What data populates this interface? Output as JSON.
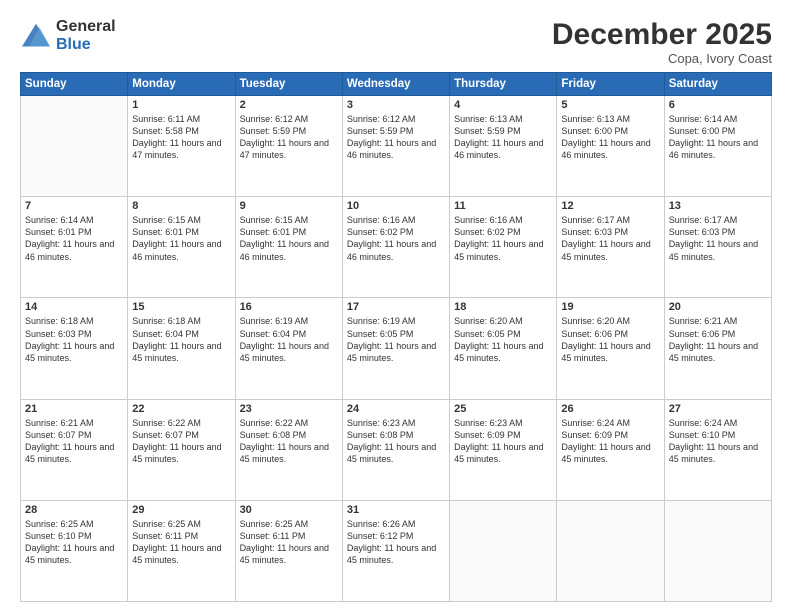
{
  "logo": {
    "general": "General",
    "blue": "Blue"
  },
  "header": {
    "month": "December 2025",
    "location": "Copa, Ivory Coast"
  },
  "days": [
    "Sunday",
    "Monday",
    "Tuesday",
    "Wednesday",
    "Thursday",
    "Friday",
    "Saturday"
  ],
  "weeks": [
    [
      {
        "day": "",
        "sunrise": "",
        "sunset": "",
        "daylight": ""
      },
      {
        "day": "1",
        "sunrise": "Sunrise: 6:11 AM",
        "sunset": "Sunset: 5:58 PM",
        "daylight": "Daylight: 11 hours and 47 minutes."
      },
      {
        "day": "2",
        "sunrise": "Sunrise: 6:12 AM",
        "sunset": "Sunset: 5:59 PM",
        "daylight": "Daylight: 11 hours and 47 minutes."
      },
      {
        "day": "3",
        "sunrise": "Sunrise: 6:12 AM",
        "sunset": "Sunset: 5:59 PM",
        "daylight": "Daylight: 11 hours and 46 minutes."
      },
      {
        "day": "4",
        "sunrise": "Sunrise: 6:13 AM",
        "sunset": "Sunset: 5:59 PM",
        "daylight": "Daylight: 11 hours and 46 minutes."
      },
      {
        "day": "5",
        "sunrise": "Sunrise: 6:13 AM",
        "sunset": "Sunset: 6:00 PM",
        "daylight": "Daylight: 11 hours and 46 minutes."
      },
      {
        "day": "6",
        "sunrise": "Sunrise: 6:14 AM",
        "sunset": "Sunset: 6:00 PM",
        "daylight": "Daylight: 11 hours and 46 minutes."
      }
    ],
    [
      {
        "day": "7",
        "sunrise": "Sunrise: 6:14 AM",
        "sunset": "Sunset: 6:01 PM",
        "daylight": "Daylight: 11 hours and 46 minutes."
      },
      {
        "day": "8",
        "sunrise": "Sunrise: 6:15 AM",
        "sunset": "Sunset: 6:01 PM",
        "daylight": "Daylight: 11 hours and 46 minutes."
      },
      {
        "day": "9",
        "sunrise": "Sunrise: 6:15 AM",
        "sunset": "Sunset: 6:01 PM",
        "daylight": "Daylight: 11 hours and 46 minutes."
      },
      {
        "day": "10",
        "sunrise": "Sunrise: 6:16 AM",
        "sunset": "Sunset: 6:02 PM",
        "daylight": "Daylight: 11 hours and 46 minutes."
      },
      {
        "day": "11",
        "sunrise": "Sunrise: 6:16 AM",
        "sunset": "Sunset: 6:02 PM",
        "daylight": "Daylight: 11 hours and 45 minutes."
      },
      {
        "day": "12",
        "sunrise": "Sunrise: 6:17 AM",
        "sunset": "Sunset: 6:03 PM",
        "daylight": "Daylight: 11 hours and 45 minutes."
      },
      {
        "day": "13",
        "sunrise": "Sunrise: 6:17 AM",
        "sunset": "Sunset: 6:03 PM",
        "daylight": "Daylight: 11 hours and 45 minutes."
      }
    ],
    [
      {
        "day": "14",
        "sunrise": "Sunrise: 6:18 AM",
        "sunset": "Sunset: 6:03 PM",
        "daylight": "Daylight: 11 hours and 45 minutes."
      },
      {
        "day": "15",
        "sunrise": "Sunrise: 6:18 AM",
        "sunset": "Sunset: 6:04 PM",
        "daylight": "Daylight: 11 hours and 45 minutes."
      },
      {
        "day": "16",
        "sunrise": "Sunrise: 6:19 AM",
        "sunset": "Sunset: 6:04 PM",
        "daylight": "Daylight: 11 hours and 45 minutes."
      },
      {
        "day": "17",
        "sunrise": "Sunrise: 6:19 AM",
        "sunset": "Sunset: 6:05 PM",
        "daylight": "Daylight: 11 hours and 45 minutes."
      },
      {
        "day": "18",
        "sunrise": "Sunrise: 6:20 AM",
        "sunset": "Sunset: 6:05 PM",
        "daylight": "Daylight: 11 hours and 45 minutes."
      },
      {
        "day": "19",
        "sunrise": "Sunrise: 6:20 AM",
        "sunset": "Sunset: 6:06 PM",
        "daylight": "Daylight: 11 hours and 45 minutes."
      },
      {
        "day": "20",
        "sunrise": "Sunrise: 6:21 AM",
        "sunset": "Sunset: 6:06 PM",
        "daylight": "Daylight: 11 hours and 45 minutes."
      }
    ],
    [
      {
        "day": "21",
        "sunrise": "Sunrise: 6:21 AM",
        "sunset": "Sunset: 6:07 PM",
        "daylight": "Daylight: 11 hours and 45 minutes."
      },
      {
        "day": "22",
        "sunrise": "Sunrise: 6:22 AM",
        "sunset": "Sunset: 6:07 PM",
        "daylight": "Daylight: 11 hours and 45 minutes."
      },
      {
        "day": "23",
        "sunrise": "Sunrise: 6:22 AM",
        "sunset": "Sunset: 6:08 PM",
        "daylight": "Daylight: 11 hours and 45 minutes."
      },
      {
        "day": "24",
        "sunrise": "Sunrise: 6:23 AM",
        "sunset": "Sunset: 6:08 PM",
        "daylight": "Daylight: 11 hours and 45 minutes."
      },
      {
        "day": "25",
        "sunrise": "Sunrise: 6:23 AM",
        "sunset": "Sunset: 6:09 PM",
        "daylight": "Daylight: 11 hours and 45 minutes."
      },
      {
        "day": "26",
        "sunrise": "Sunrise: 6:24 AM",
        "sunset": "Sunset: 6:09 PM",
        "daylight": "Daylight: 11 hours and 45 minutes."
      },
      {
        "day": "27",
        "sunrise": "Sunrise: 6:24 AM",
        "sunset": "Sunset: 6:10 PM",
        "daylight": "Daylight: 11 hours and 45 minutes."
      }
    ],
    [
      {
        "day": "28",
        "sunrise": "Sunrise: 6:25 AM",
        "sunset": "Sunset: 6:10 PM",
        "daylight": "Daylight: 11 hours and 45 minutes."
      },
      {
        "day": "29",
        "sunrise": "Sunrise: 6:25 AM",
        "sunset": "Sunset: 6:11 PM",
        "daylight": "Daylight: 11 hours and 45 minutes."
      },
      {
        "day": "30",
        "sunrise": "Sunrise: 6:25 AM",
        "sunset": "Sunset: 6:11 PM",
        "daylight": "Daylight: 11 hours and 45 minutes."
      },
      {
        "day": "31",
        "sunrise": "Sunrise: 6:26 AM",
        "sunset": "Sunset: 6:12 PM",
        "daylight": "Daylight: 11 hours and 45 minutes."
      },
      {
        "day": "",
        "sunrise": "",
        "sunset": "",
        "daylight": ""
      },
      {
        "day": "",
        "sunrise": "",
        "sunset": "",
        "daylight": ""
      },
      {
        "day": "",
        "sunrise": "",
        "sunset": "",
        "daylight": ""
      }
    ]
  ]
}
